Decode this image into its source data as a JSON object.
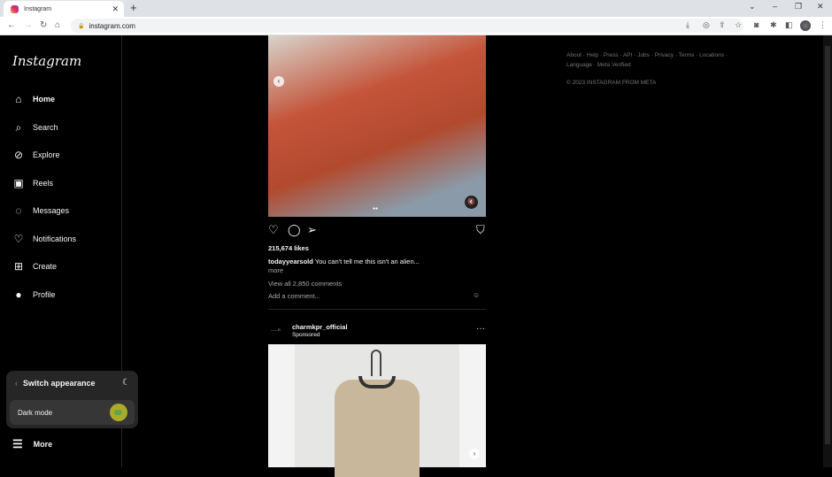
{
  "browser": {
    "tab_title": "Instagram",
    "url": "instagram.com"
  },
  "sidebar": {
    "logo": "Instagram",
    "items": [
      {
        "label": "Home",
        "icon": "home-icon"
      },
      {
        "label": "Search",
        "icon": "search-icon"
      },
      {
        "label": "Explore",
        "icon": "compass-icon"
      },
      {
        "label": "Reels",
        "icon": "reels-icon"
      },
      {
        "label": "Messages",
        "icon": "messenger-icon"
      },
      {
        "label": "Notifications",
        "icon": "heart-icon"
      },
      {
        "label": "Create",
        "icon": "plus-square-icon"
      },
      {
        "label": "Profile",
        "icon": "avatar-icon"
      }
    ],
    "more": "More"
  },
  "appearance": {
    "title": "Switch appearance",
    "dark_mode_label": "Dark mode",
    "dark_mode_on": true
  },
  "post": {
    "likes": "215,674 likes",
    "username": "todayyearsold",
    "caption": "You can't tell me this isn't an alien...",
    "more": "more",
    "view_comments": "View all 2,850 comments",
    "comment_placeholder": "Add a comment..."
  },
  "post2": {
    "username": "charmkpr_official",
    "sponsored": "Sponsored"
  },
  "footer": {
    "links": "About · Help · Press · API · Jobs · Privacy · Terms · Locations ·",
    "links2": "Language · Meta Verified",
    "copyright": "© 2023 INSTAGRAM FROM META"
  }
}
